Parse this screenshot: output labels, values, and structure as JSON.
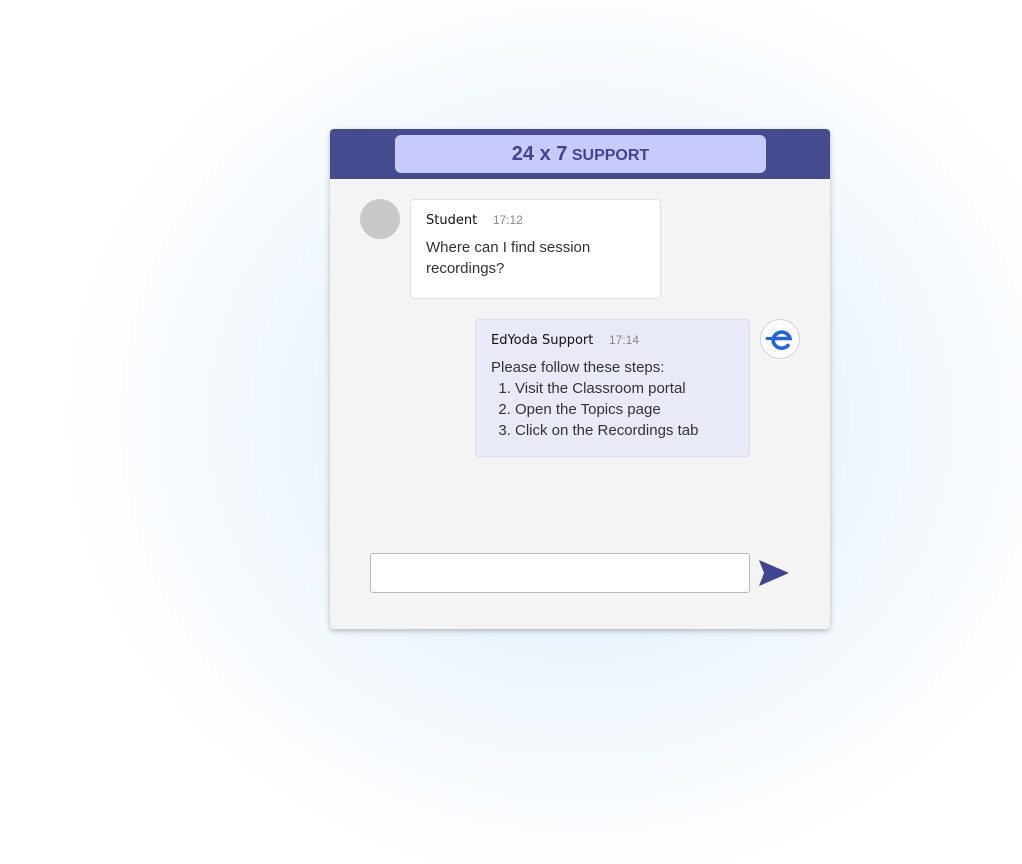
{
  "header": {
    "title_main": "24 x 7",
    "title_sub": "SUPPORT"
  },
  "messages": [
    {
      "sender": "Student",
      "time": "17:12",
      "text": "Where can I find session recordings?"
    },
    {
      "sender": "EdYoda Support",
      "time": "17:14",
      "intro": "Please follow these steps:",
      "steps": [
        "Visit the Classroom portal",
        "Open the Topics page",
        "Click on the Recordings tab"
      ]
    }
  ],
  "composer": {
    "placeholder": "",
    "value": ""
  },
  "icons": {
    "support_avatar": "edyoda-logo-icon",
    "send": "send-icon"
  },
  "colors": {
    "header_bg": "#444b8e",
    "header_pill": "#c9cafc",
    "support_bubble": "#e8eaf8",
    "brand_blue": "#1f63e8"
  }
}
